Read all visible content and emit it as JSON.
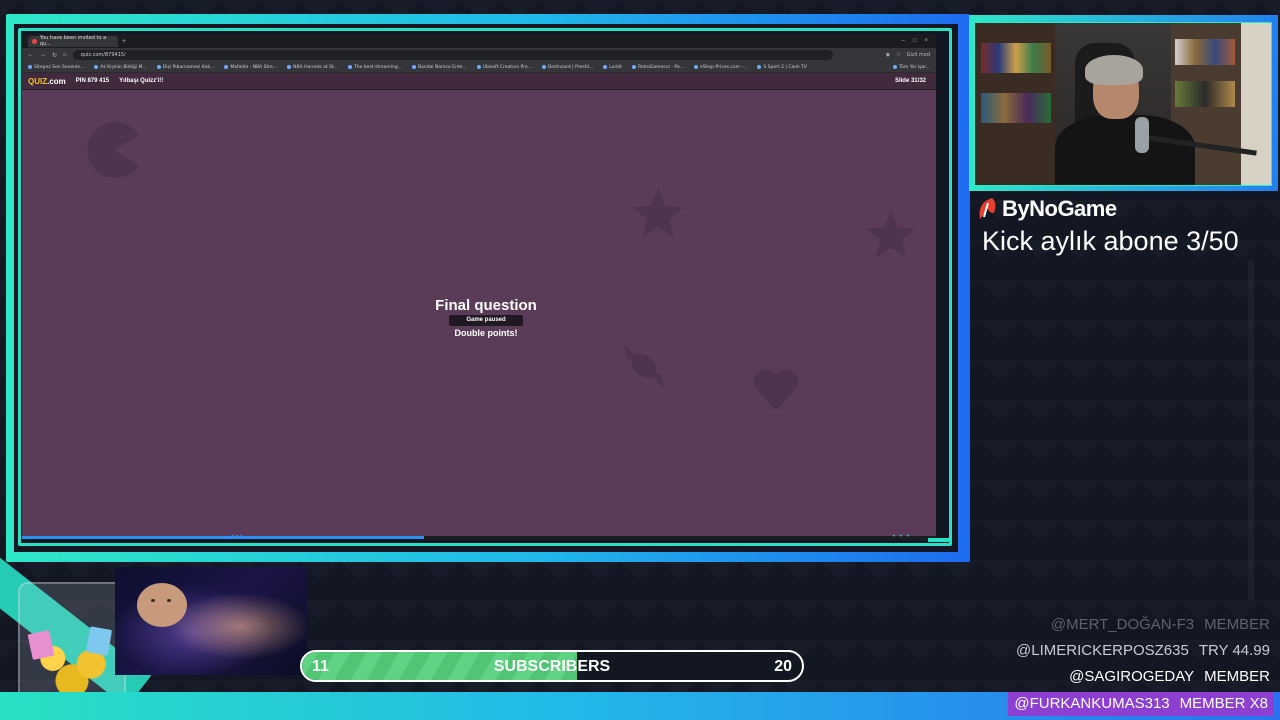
{
  "browser": {
    "tab_title": "You have been invited to a qu...",
    "url": "quiz.com/879415/",
    "profile_label": "Gizli mod",
    "bookmarks": [
      "Sitepnz Son Sevenle...",
      "Az Kişinin Bildiği M...",
      "Dişi İhbarnamesi Kak...",
      "Mafalde - NBA Stre...",
      "NBA Hornets at St...",
      "The best streaming...",
      "Bandai Namco Ente...",
      "Ubisoft Creators Pro...",
      "Destnzard | Prestil...",
      "Lurkit",
      "RetroGamesrz - Pa...",
      "eShop-Prices.com -...",
      "S Sport 2 | Canlı TV"
    ],
    "bookmarks_right": "Tüm Yer işar..."
  },
  "quiz": {
    "logo_main": "QUIZ",
    "logo_suffix": ".com",
    "pin": "PIN 879 415",
    "title": "Yılbaşı Quizz'i!!",
    "slide": "Slide 31/32",
    "final_question": "Final question",
    "paused": "Game paused",
    "double_points": "Double points!",
    "progress_fraction": 0.44
  },
  "overlay": {
    "brand_name": "ByNoGame",
    "kick_line": "Kick aylık abone 3/50",
    "subscribers": {
      "current": "11",
      "label": "SUBSCRIBERS",
      "goal": "20",
      "fill_fraction": 0.55
    },
    "members": [
      {
        "name": "@MERT_DOĞAN-F3",
        "tag": "MEMBER"
      },
      {
        "name": "@LIMERICKERPOSZ635",
        "tag": "TRY 44.99"
      },
      {
        "name": "@SAGIROGEDAY",
        "tag": "MEMBER"
      }
    ],
    "highlight_member": {
      "name": "@FURKANKUMAS313",
      "tag": "MEMBER X8"
    }
  },
  "colors": {
    "accent_teal": "#28e0c3",
    "accent_blue": "#2080ef",
    "quiz_bg": "#5a3c58",
    "sub_fill": "#5fd383",
    "highlight": "#8c3fd1"
  }
}
